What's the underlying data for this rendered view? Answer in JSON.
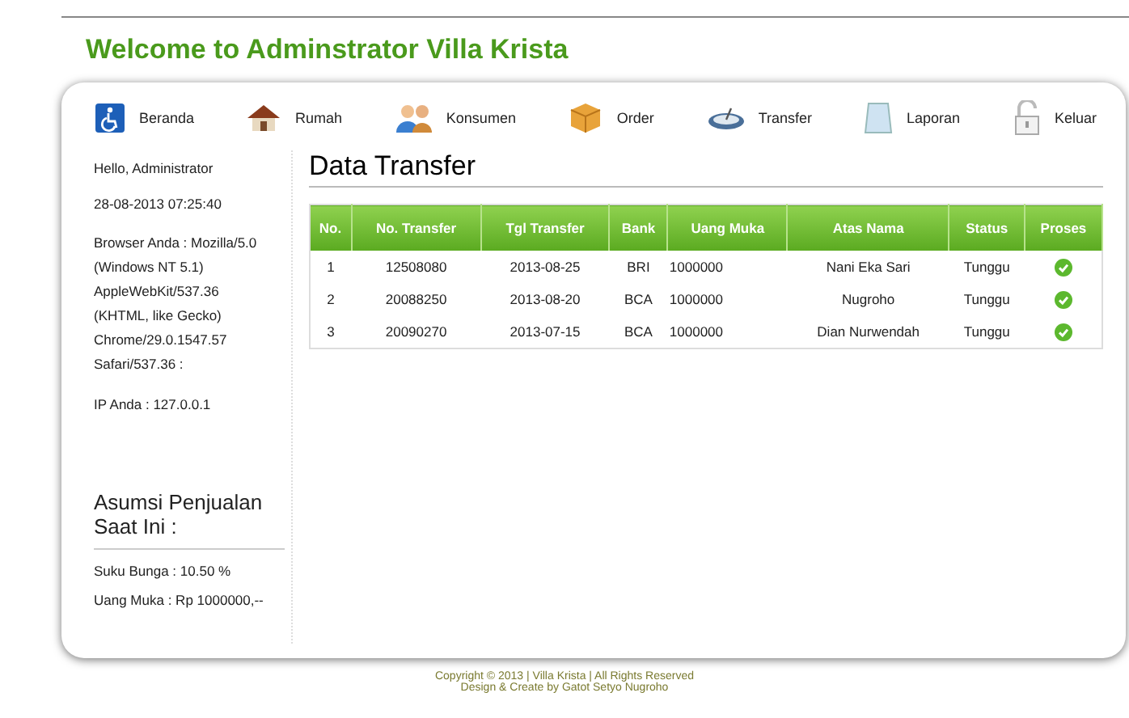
{
  "site_title": "Welcome to Adminstrator Villa Krista",
  "nav": [
    {
      "label": "Beranda",
      "kind": "wheelchair"
    },
    {
      "label": "Rumah",
      "kind": "house"
    },
    {
      "label": "Konsumen",
      "kind": "people"
    },
    {
      "label": "Order",
      "kind": "box"
    },
    {
      "label": "Transfer",
      "kind": "dish"
    },
    {
      "label": "Laporan",
      "kind": "paper"
    },
    {
      "label": "Keluar",
      "kind": "lock"
    }
  ],
  "sidebar": {
    "greeting": "Hello, Administrator",
    "datetime": "28-08-2013 07:25:40",
    "browser": "Browser Anda : Mozilla/5.0 (Windows NT 5.1) AppleWebKit/537.36 (KHTML, like Gecko) Chrome/29.0.1547.57 Safari/537.36 :",
    "ip": "IP Anda : 127.0.0.1",
    "section_title": "Asumsi Penjualan Saat Ini :",
    "facts": [
      "Suku Bunga : 10.50 %",
      "Uang Muka : Rp 1000000,--"
    ]
  },
  "page_title": "Data Transfer",
  "table": {
    "columns": [
      "No.",
      "No. Transfer",
      "Tgl Transfer",
      "Bank",
      "Uang Muka",
      "Atas Nama",
      "Status",
      "Proses"
    ],
    "rows": [
      [
        "1",
        "12508080",
        "2013-08-25",
        "BRI",
        "1000000",
        "Nani Eka Sari",
        "Tunggu"
      ],
      [
        "2",
        "20088250",
        "2013-08-20",
        "BCA",
        "1000000",
        "Nugroho",
        "Tunggu"
      ],
      [
        "3",
        "20090270",
        "2013-07-15",
        "BCA",
        "1000000",
        "Dian Nurwendah",
        "Tunggu"
      ]
    ]
  },
  "footer": [
    "Copyright © 2013 | Villa Krista | All Rights Reserved",
    "Design & Create by Gatot Setyo Nugroho"
  ]
}
